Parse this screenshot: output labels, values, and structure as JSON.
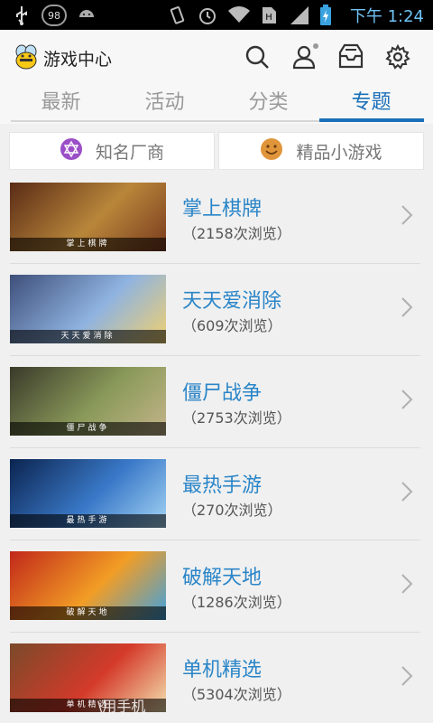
{
  "status_bar": {
    "battery_badge": "98",
    "time": "下午 1:24"
  },
  "header": {
    "title": "游戏中心",
    "icons": [
      "search-icon",
      "user-icon",
      "inbox-icon",
      "gear-icon"
    ]
  },
  "tabs": [
    {
      "label": "最新",
      "active": false
    },
    {
      "label": "活动",
      "active": false
    },
    {
      "label": "分类",
      "active": false
    },
    {
      "label": "专题",
      "active": true
    }
  ],
  "sub_buttons": [
    {
      "label": "知名厂商",
      "icon": "star-of-david-icon",
      "color": "#9b4fc7"
    },
    {
      "label": "精品小游戏",
      "icon": "smiley-icon",
      "color": "#e0953a"
    }
  ],
  "items": [
    {
      "title": "掌上棋牌",
      "views": "（2158次浏览）",
      "caption": "掌上棋牌",
      "thumb_colors": [
        "#5a2b16",
        "#b8863a",
        "#7a3b1e"
      ]
    },
    {
      "title": "天天爱消除",
      "views": "（609次浏览）",
      "caption": "天天爱消除",
      "thumb_colors": [
        "#3e4f7a",
        "#8fb3e0",
        "#f0d070"
      ]
    },
    {
      "title": "僵尸战争",
      "views": "（2753次浏览）",
      "caption": "僵尸战争",
      "thumb_colors": [
        "#3a3a2a",
        "#8a9a5a",
        "#c4b48a"
      ]
    },
    {
      "title": "最热手游",
      "views": "（270次浏览）",
      "caption": "最热手游",
      "thumb_colors": [
        "#0b2450",
        "#3a79c8",
        "#a4d4f4"
      ]
    },
    {
      "title": "破解天地",
      "views": "（1286次浏览）",
      "caption": "破解天地",
      "thumb_colors": [
        "#c1281a",
        "#f29d25",
        "#3fa1e0"
      ]
    },
    {
      "title": "单机精选",
      "views": "（5304次浏览）",
      "caption": "单机精选",
      "thumb_colors": [
        "#7a4a2a",
        "#d43a2a",
        "#f4e2b0"
      ]
    }
  ],
  "watermark": "\\用手机"
}
